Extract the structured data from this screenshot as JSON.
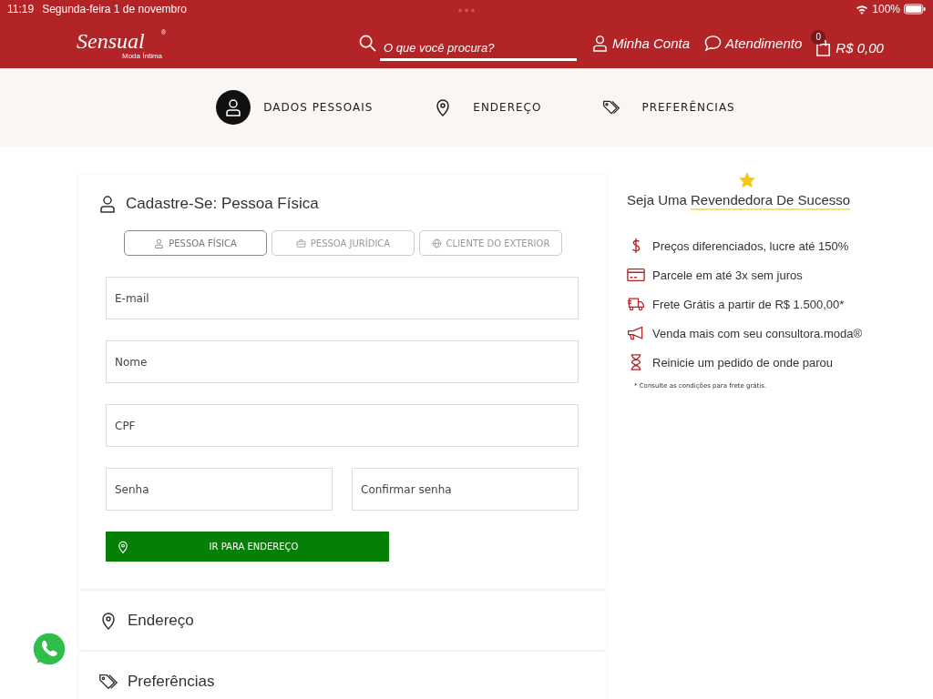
{
  "status_bar": {
    "time": "11:19",
    "date": "Segunda-feira 1 de novembro",
    "battery": "100%"
  },
  "header": {
    "logo": "Sensual",
    "logo_mark": "®",
    "logo_sub": "Moda Íntima",
    "search": {
      "placeholder": "O que você procura?"
    },
    "account": "Minha Conta",
    "support": "Atendimento",
    "cart_count": "0",
    "cart_total": "R$ 0,00"
  },
  "steps": [
    {
      "label": "DADOS PESSOAIS",
      "kind": "person",
      "selected": true
    },
    {
      "label": "ENDEREÇO",
      "kind": "pin",
      "selected": false
    },
    {
      "label": "PREFERÊNCIAS",
      "kind": "tags",
      "selected": false
    }
  ],
  "form": {
    "title": "Cadastre-Se: Pessoa Física",
    "tabs": [
      {
        "label": "PESSOA FÍSICA",
        "kind": "person",
        "selected": true
      },
      {
        "label": "PESSOA JURÍDICA",
        "kind": "briefcase",
        "selected": false
      },
      {
        "label": "CLIENTE DO EXTERIOR",
        "kind": "globe",
        "selected": false
      }
    ],
    "fields": [
      [
        {
          "placeholder": "E-mail"
        }
      ],
      [
        {
          "placeholder": "Nome"
        }
      ],
      [
        {
          "placeholder": "CPF"
        }
      ],
      [
        {
          "placeholder": "Senha"
        },
        {
          "placeholder": "Confirmar senha"
        }
      ]
    ],
    "submit": "IR PARA ENDEREÇO"
  },
  "sections": [
    {
      "label": "Endereço",
      "kind": "pin"
    },
    {
      "label": "Preferências",
      "kind": "tags"
    }
  ],
  "sidebar": {
    "title_plain": "Seja Uma",
    "title_highlight": "Revendedora De Sucesso",
    "benefits": [
      {
        "text": "Preços diferenciados, lucre até 150%",
        "kind": "dollar"
      },
      {
        "text": "Parcele em até 3x sem juros",
        "kind": "card"
      },
      {
        "text": "Frete Grátis a partir de R$ 1.500,00*",
        "kind": "truck"
      },
      {
        "text": "Venda mais com seu consultora.moda®",
        "kind": "megaphone"
      },
      {
        "text": "Reinicie um pedido de onde parou",
        "kind": "hourglass"
      }
    ],
    "note": "* Consulte as condições para frete grátis."
  }
}
